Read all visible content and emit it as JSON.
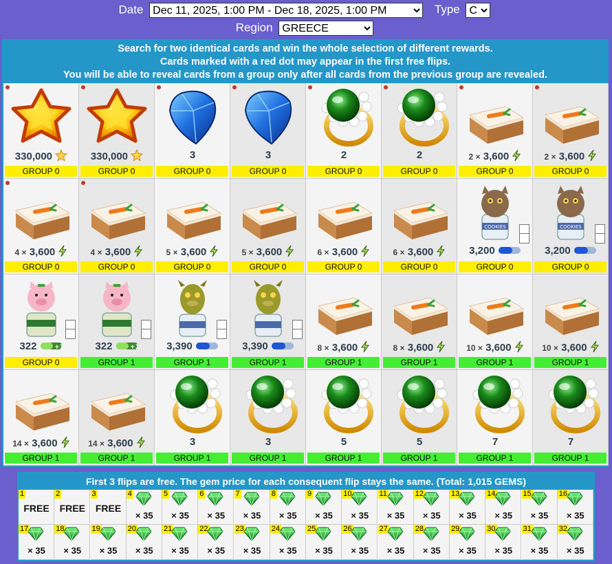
{
  "filters": {
    "date_label": "Date",
    "date_value": "Dec 11, 2025, 1:00 PM - Dec 18, 2025, 1:00 PM",
    "type_label": "Type",
    "type_value": "C",
    "region_label": "Region",
    "region_value": "GREECE"
  },
  "instructions": [
    "Search for two identical cards and win the whole selection of different rewards.",
    "Cards marked with a red dot may appear in the first free flips.",
    "You will be able to reveal cards from a group only after all cards from the previous group are revealed."
  ],
  "cards": [
    {
      "item": "star",
      "mult": "",
      "value": "330,000",
      "unit": "star-icon",
      "group": "GROUP 0",
      "red_dot": true,
      "box": false
    },
    {
      "item": "star",
      "mult": "",
      "value": "330,000",
      "unit": "star-icon",
      "group": "GROUP 0",
      "red_dot": true,
      "box": false
    },
    {
      "item": "crystal",
      "mult": "",
      "value": "3",
      "unit": "",
      "group": "GROUP 0",
      "red_dot": true,
      "box": false
    },
    {
      "item": "crystal",
      "mult": "",
      "value": "3",
      "unit": "",
      "group": "GROUP 0",
      "red_dot": true,
      "box": false
    },
    {
      "item": "ring",
      "mult": "",
      "value": "2",
      "unit": "",
      "group": "GROUP 0",
      "red_dot": true,
      "box": false
    },
    {
      "item": "ring",
      "mult": "",
      "value": "2",
      "unit": "",
      "group": "GROUP 0",
      "red_dot": true,
      "box": false
    },
    {
      "item": "cake",
      "mult": "2 ×",
      "value": "3,600",
      "unit": "bolt-icon",
      "group": "GROUP 0",
      "red_dot": true,
      "box": false
    },
    {
      "item": "cake",
      "mult": "2 ×",
      "value": "3,600",
      "unit": "bolt-icon",
      "group": "GROUP 0",
      "red_dot": true,
      "box": false
    },
    {
      "item": "cake",
      "mult": "4 ×",
      "value": "3,600",
      "unit": "bolt-icon",
      "group": "GROUP 0",
      "red_dot": true,
      "box": false
    },
    {
      "item": "cake",
      "mult": "4 ×",
      "value": "3,600",
      "unit": "bolt-icon",
      "group": "GROUP 0",
      "red_dot": true,
      "box": false
    },
    {
      "item": "cake",
      "mult": "5 ×",
      "value": "3,600",
      "unit": "bolt-icon",
      "group": "GROUP 0",
      "red_dot": false,
      "box": false
    },
    {
      "item": "cake",
      "mult": "5 ×",
      "value": "3,600",
      "unit": "bolt-icon",
      "group": "GROUP 0",
      "red_dot": false,
      "box": false
    },
    {
      "item": "cake",
      "mult": "6 ×",
      "value": "3,600",
      "unit": "bolt-icon",
      "group": "GROUP 0",
      "red_dot": false,
      "box": false
    },
    {
      "item": "cake",
      "mult": "6 ×",
      "value": "3,600",
      "unit": "bolt-icon",
      "group": "GROUP 0",
      "red_dot": false,
      "box": false
    },
    {
      "item": "cat-jar",
      "mult": "",
      "value": "3,200",
      "unit": "pill-icon",
      "group": "GROUP 0",
      "red_dot": false,
      "box": true
    },
    {
      "item": "cat-jar",
      "mult": "",
      "value": "3,200",
      "unit": "pill-icon",
      "group": "GROUP 0",
      "red_dot": false,
      "box": true
    },
    {
      "item": "pig-jar",
      "mult": "",
      "value": "322",
      "unit": "pill-plus-icon",
      "group": "GROUP 0",
      "red_dot": false,
      "box": true
    },
    {
      "item": "pig-jar",
      "mult": "",
      "value": "322",
      "unit": "pill-plus-icon",
      "group": "GROUP 1",
      "red_dot": false,
      "box": true
    },
    {
      "item": "dragon-jar",
      "mult": "",
      "value": "3,390",
      "unit": "pill-icon",
      "group": "GROUP 1",
      "red_dot": false,
      "box": true
    },
    {
      "item": "dragon-jar",
      "mult": "",
      "value": "3,390",
      "unit": "pill-icon",
      "group": "GROUP 1",
      "red_dot": false,
      "box": true
    },
    {
      "item": "cake",
      "mult": "8 ×",
      "value": "3,600",
      "unit": "bolt-icon",
      "group": "GROUP 1",
      "red_dot": false,
      "box": false
    },
    {
      "item": "cake",
      "mult": "8 ×",
      "value": "3,600",
      "unit": "bolt-icon",
      "group": "GROUP 1",
      "red_dot": false,
      "box": false
    },
    {
      "item": "cake",
      "mult": "10 ×",
      "value": "3,600",
      "unit": "bolt-icon",
      "group": "GROUP 1",
      "red_dot": false,
      "box": false
    },
    {
      "item": "cake",
      "mult": "10 ×",
      "value": "3,600",
      "unit": "bolt-icon",
      "group": "GROUP 1",
      "red_dot": false,
      "box": false
    },
    {
      "item": "cake",
      "mult": "14 ×",
      "value": "3,600",
      "unit": "bolt-icon",
      "group": "GROUP 1",
      "red_dot": false,
      "box": false
    },
    {
      "item": "cake",
      "mult": "14 ×",
      "value": "3,600",
      "unit": "bolt-icon",
      "group": "GROUP 1",
      "red_dot": false,
      "box": false
    },
    {
      "item": "ring",
      "mult": "",
      "value": "3",
      "unit": "",
      "group": "GROUP 1",
      "red_dot": false,
      "box": false
    },
    {
      "item": "ring",
      "mult": "",
      "value": "3",
      "unit": "",
      "group": "GROUP 1",
      "red_dot": false,
      "box": false
    },
    {
      "item": "ring",
      "mult": "",
      "value": "5",
      "unit": "",
      "group": "GROUP 1",
      "red_dot": false,
      "box": false
    },
    {
      "item": "ring",
      "mult": "",
      "value": "5",
      "unit": "",
      "group": "GROUP 1",
      "red_dot": false,
      "box": false
    },
    {
      "item": "ring",
      "mult": "",
      "value": "7",
      "unit": "",
      "group": "GROUP 1",
      "red_dot": false,
      "box": false
    },
    {
      "item": "ring",
      "mult": "",
      "value": "7",
      "unit": "",
      "group": "GROUP 1",
      "red_dot": false,
      "box": false
    }
  ],
  "flips": {
    "header": "First 3 flips are free. The gem price for each consequent flip stays the same. (Total: 1,015 GEMS)",
    "items": [
      {
        "n": "1",
        "label": "FREE"
      },
      {
        "n": "2",
        "label": "FREE"
      },
      {
        "n": "3",
        "label": "FREE"
      },
      {
        "n": "4",
        "label": "× 35"
      },
      {
        "n": "5",
        "label": "× 35"
      },
      {
        "n": "6",
        "label": "× 35"
      },
      {
        "n": "7",
        "label": "× 35"
      },
      {
        "n": "8",
        "label": "× 35"
      },
      {
        "n": "9",
        "label": "× 35"
      },
      {
        "n": "10",
        "label": "× 35"
      },
      {
        "n": "11",
        "label": "× 35"
      },
      {
        "n": "12",
        "label": "× 35"
      },
      {
        "n": "13",
        "label": "× 35"
      },
      {
        "n": "14",
        "label": "× 35"
      },
      {
        "n": "15",
        "label": "× 35"
      },
      {
        "n": "16",
        "label": "× 35"
      },
      {
        "n": "17",
        "label": "× 35"
      },
      {
        "n": "18",
        "label": "× 35"
      },
      {
        "n": "19",
        "label": "× 35"
      },
      {
        "n": "20",
        "label": "× 35"
      },
      {
        "n": "21",
        "label": "× 35"
      },
      {
        "n": "22",
        "label": "× 35"
      },
      {
        "n": "23",
        "label": "× 35"
      },
      {
        "n": "24",
        "label": "× 35"
      },
      {
        "n": "25",
        "label": "× 35"
      },
      {
        "n": "26",
        "label": "× 35"
      },
      {
        "n": "27",
        "label": "× 35"
      },
      {
        "n": "28",
        "label": "× 35"
      },
      {
        "n": "29",
        "label": "× 35"
      },
      {
        "n": "30",
        "label": "× 35"
      },
      {
        "n": "31",
        "label": "× 35"
      },
      {
        "n": "32",
        "label": "× 35"
      }
    ]
  },
  "colors": {
    "page_bg": "#6a5fcc",
    "header_blue": "#2596c8",
    "group0": "#ffee00",
    "group1": "#44ee33"
  }
}
